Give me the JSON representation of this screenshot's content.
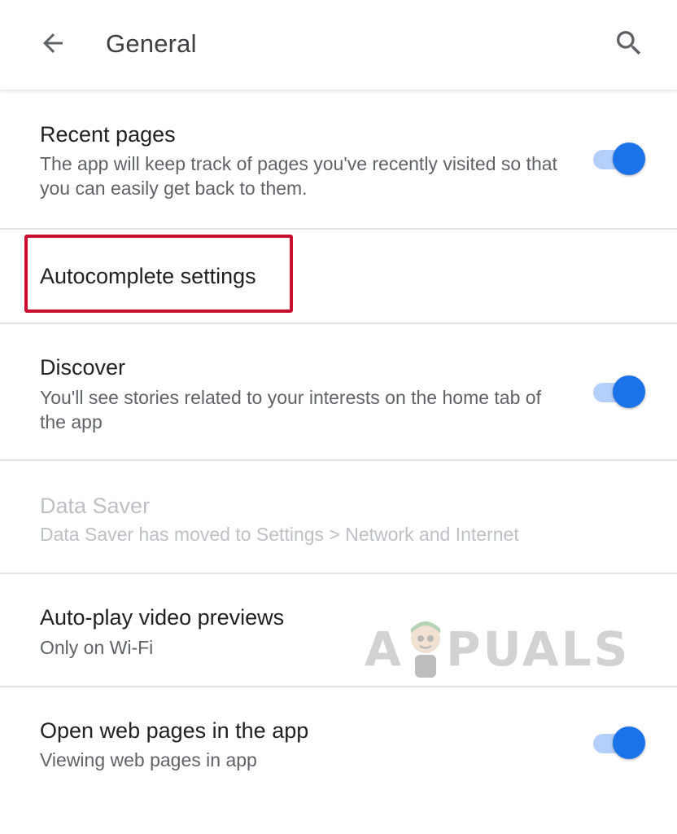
{
  "app_bar": {
    "title": "General",
    "back_icon": "arrow-back-icon",
    "search_icon": "search-icon"
  },
  "settings": {
    "recent_pages": {
      "title": "Recent pages",
      "subtitle": "The app will keep track of pages you've recently visited so that you can easily get back to them.",
      "toggle_on": true
    },
    "autocomplete": {
      "title": "Autocomplete settings"
    },
    "discover": {
      "title": "Discover",
      "subtitle": "You'll see stories related to your interests on the home tab of the app",
      "toggle_on": true
    },
    "data_saver": {
      "title": "Data Saver",
      "subtitle": "Data Saver has moved to Settings > Network and Internet",
      "disabled": true
    },
    "autoplay": {
      "title": "Auto-play video previews",
      "subtitle": "Only on Wi-Fi"
    },
    "open_web_pages": {
      "title": "Open web pages in the app",
      "subtitle": "Viewing web pages in app",
      "toggle_on": true
    }
  },
  "watermark": {
    "text_a": "A",
    "text_rest": "PUALS"
  },
  "colors": {
    "accent": "#1a73e8",
    "track": "#a8c7fa",
    "highlight": "#c8102e",
    "title_text": "#202124",
    "secondary_text": "#5f6368",
    "disabled_text": "#bdc1c6",
    "divider": "#e3e3e3"
  }
}
